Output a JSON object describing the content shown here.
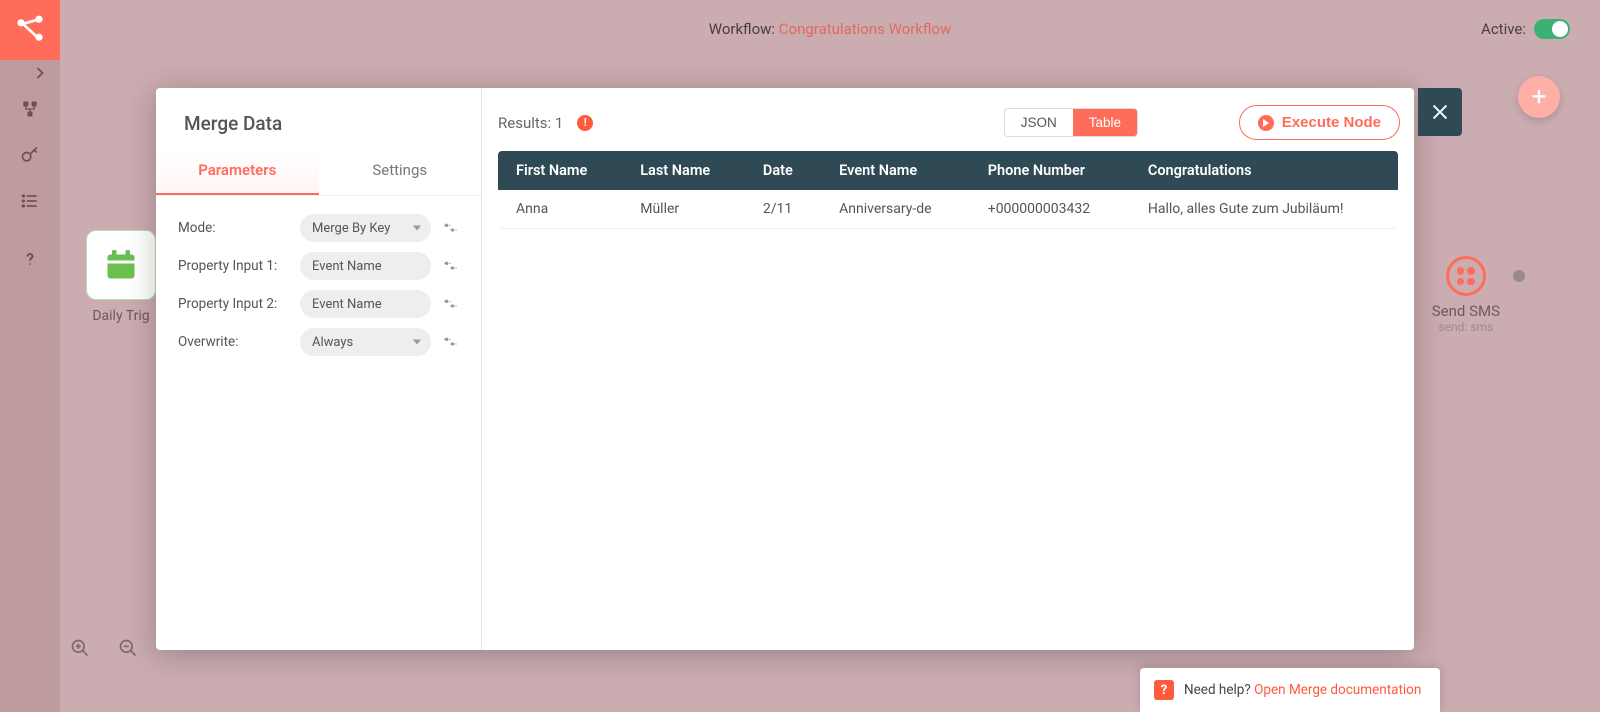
{
  "topbar": {
    "prefix": "Workflow: ",
    "name": "Congratulations Workflow",
    "active_label": "Active:",
    "active": true
  },
  "rail": {
    "items": [
      "workflows",
      "credentials",
      "executions"
    ]
  },
  "modal": {
    "title": "Merge Data",
    "tabs": {
      "parameters": "Parameters",
      "settings": "Settings",
      "active": "parameters"
    },
    "params": {
      "mode": {
        "label": "Mode:",
        "value": "Merge By Key"
      },
      "property_input_1": {
        "label": "Property Input 1:",
        "value": "Event Name"
      },
      "property_input_2": {
        "label": "Property Input 2:",
        "value": "Event Name"
      },
      "overwrite": {
        "label": "Overwrite:",
        "value": "Always"
      }
    },
    "results": {
      "label_prefix": "Results: ",
      "count": "1",
      "view": "Table",
      "json_label": "JSON",
      "table_label": "Table",
      "execute_label": "Execute Node",
      "columns": [
        "First Name",
        "Last Name",
        "Date",
        "Event Name",
        "Phone Number",
        "Congratulations"
      ],
      "rows": [
        {
          "first_name": "Anna",
          "last_name": "Müller",
          "date": "2/11",
          "event_name": "Anniversary-de",
          "phone": "+000000003432",
          "congrats": "Hallo, alles Gute zum Jubiläum!"
        }
      ]
    }
  },
  "canvas": {
    "daily_trigger": "Daily Trig",
    "send_sms": {
      "title": "Send SMS",
      "sub": "send: sms"
    }
  },
  "help": {
    "prompt": "Need help? ",
    "link": "Open Merge documentation"
  }
}
